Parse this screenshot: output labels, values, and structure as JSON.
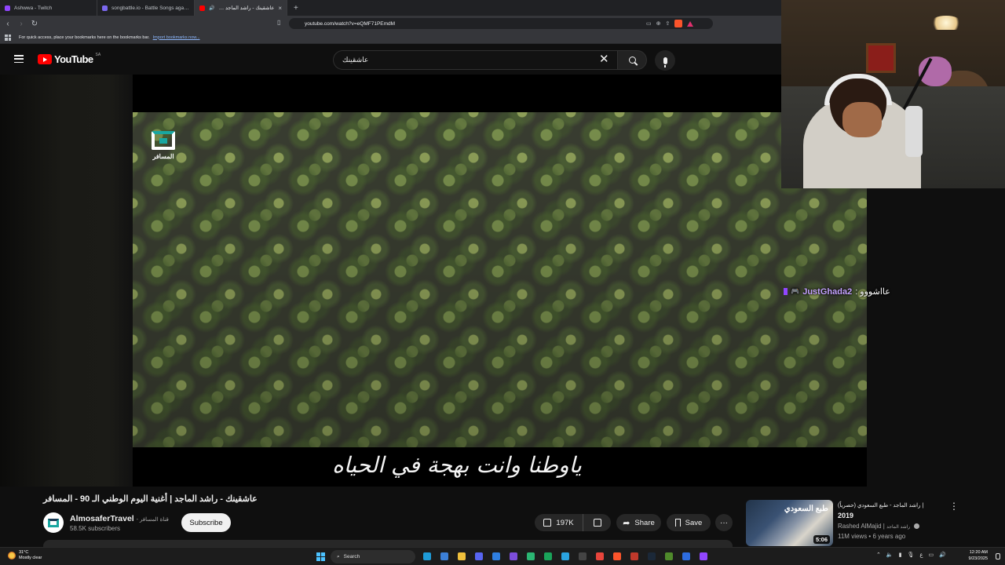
{
  "browser": {
    "tabs": [
      {
        "label": "Ashwwa - Twitch",
        "favicon_color": "#9146ff",
        "active": false
      },
      {
        "label": "songbattle.io - Battle Songs against",
        "favicon_color": "#7b68ee",
        "active": false
      },
      {
        "label": "عاشقينك - راشد الماجد | أغنية",
        "favicon_color": "#ff0000",
        "active": true
      }
    ],
    "new_tab": "+",
    "url": "youtube.com/watch?v=eQMF71PEmdM",
    "bookmarks_text": "For quick access, place your bookmarks here on the bookmarks bar.",
    "bookmarks_link": "Import bookmarks now..."
  },
  "youtube": {
    "logo_text": "YouTube",
    "country_code": "SA",
    "search_value": "عاشقينك"
  },
  "player": {
    "watermark_text": "المسافر",
    "subtitle": "ياوطنا وانت   بهجة في الحياه"
  },
  "stream": {
    "chat_user": "JustGhada2",
    "chat_message": "عااشووو :"
  },
  "video": {
    "title": "عاشقينك - راشد الماجد | أغنية اليوم الوطني الـ 90 - المسافر",
    "channel_name": "AlmosaferTravel",
    "channel_name_ar": "- قناة المسافر",
    "subscribers": "58.5K subscribers",
    "subscribe_label": "Subscribe",
    "likes": "197K",
    "share_label": "Share",
    "save_label": "Save",
    "more_label": "···"
  },
  "recommended": {
    "thumb_text": "طبع السعودي",
    "duration": "5:06",
    "title_ar": "راشد الماجد - طبع السعودي (حصرياً) |",
    "title_year": "2019",
    "channel": "Rashed AlMajid |",
    "channel_ar": "راشد الماجد",
    "meta": "11M views • 6 years ago",
    "menu": "⋮"
  },
  "taskbar": {
    "temperature": "31°C",
    "weather": "Mostly clear",
    "search_label": "Search",
    "time": "12:20 AM",
    "date": "9/23/2025",
    "lang": "ع",
    "apps": [
      {
        "name": "edge-icon",
        "color": "#1e9bd7"
      },
      {
        "name": "mail-icon",
        "color": "#3c7fd6"
      },
      {
        "name": "explorer-icon",
        "color": "#f0c03c"
      },
      {
        "name": "discord-icon",
        "color": "#5865f2"
      },
      {
        "name": "pen-icon",
        "color": "#2f7fe0"
      },
      {
        "name": "obsidian-icon",
        "color": "#7c4ddb"
      },
      {
        "name": "game-icon",
        "color": "#2bb673"
      },
      {
        "name": "green-app-icon",
        "color": "#1aa35a"
      },
      {
        "name": "telegram-icon",
        "color": "#2aa3e0"
      },
      {
        "name": "github-icon",
        "color": "#444444"
      },
      {
        "name": "chrome-icon",
        "color": "#e8453c"
      },
      {
        "name": "brave-icon",
        "color": "#fb542b"
      },
      {
        "name": "red-app-icon",
        "color": "#c0392b"
      },
      {
        "name": "steam-icon",
        "color": "#1b2838"
      },
      {
        "name": "minecraft-icon",
        "color": "#4f8a2b"
      },
      {
        "name": "window-app-icon",
        "color": "#2d6cdf"
      },
      {
        "name": "twitch-icon",
        "color": "#9146ff"
      }
    ]
  }
}
